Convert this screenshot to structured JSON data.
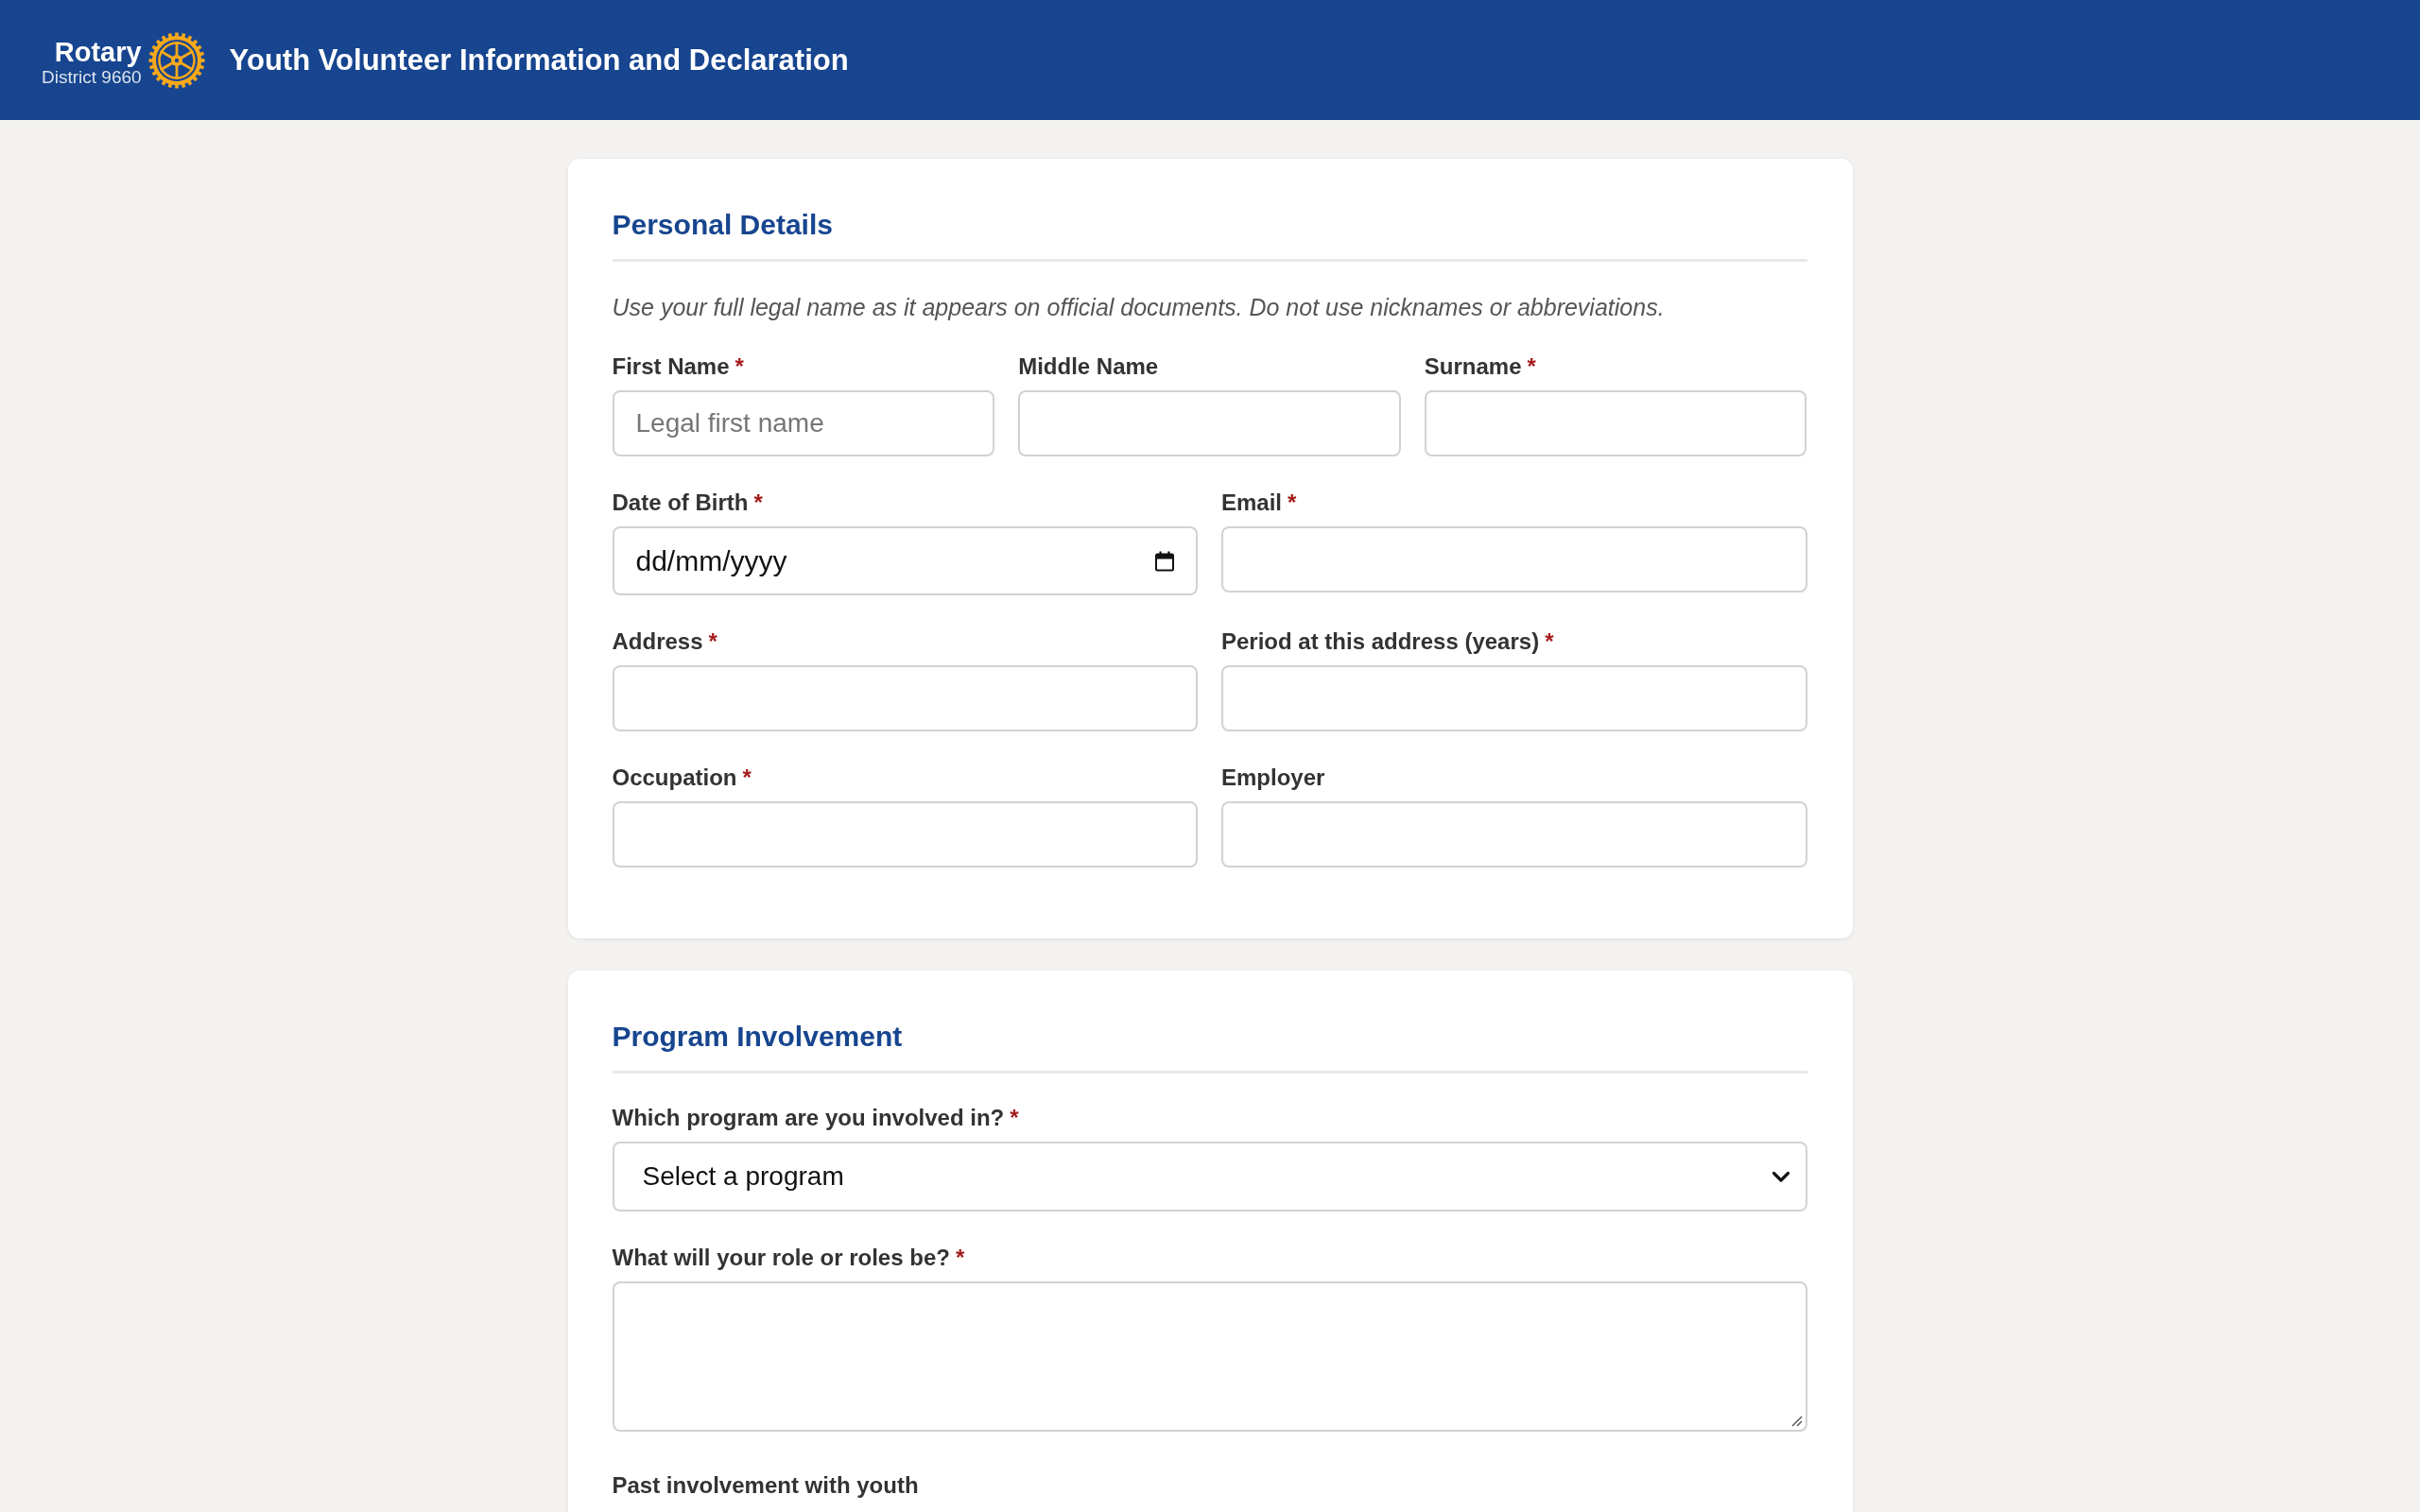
{
  "header": {
    "logo": {
      "wordmark": "Rotary",
      "district": "District 9660"
    },
    "title": "Youth Volunteer Information and Declaration"
  },
  "sections": [
    {
      "title": "Personal Details",
      "note": "Use your full legal name as it appears on official documents. Do not use nicknames or abbreviations.",
      "rows": [
        {
          "fields": [
            {
              "kind": "text",
              "label": "First Name",
              "required_mark": "*",
              "placeholder": "Legal first name"
            },
            {
              "kind": "text",
              "label": "Middle Name"
            },
            {
              "kind": "text",
              "label": "Surname",
              "required_mark": "*"
            }
          ]
        },
        {
          "fields": [
            {
              "kind": "date",
              "label": "Date of Birth",
              "required_mark": "*",
              "placeholder": "dd/mm/yyyy"
            },
            {
              "kind": "text",
              "label": "Email",
              "required_mark": "*"
            }
          ]
        },
        {
          "fields": [
            {
              "kind": "text",
              "label": "Address",
              "required_mark": "*"
            },
            {
              "kind": "text",
              "label": "Period at this address (years)",
              "required_mark": "*"
            }
          ]
        },
        {
          "fields": [
            {
              "kind": "text",
              "label": "Occupation",
              "required_mark": "*"
            },
            {
              "kind": "text",
              "label": "Employer"
            }
          ]
        }
      ]
    },
    {
      "title": "Program Involvement",
      "rows": [
        {
          "fields": [
            {
              "kind": "select",
              "label": "Which program are you involved in?",
              "required_mark": "*",
              "value": "Select a program"
            }
          ]
        },
        {
          "fields": [
            {
              "kind": "textarea",
              "label": "What will your role or roles be?",
              "required_mark": "*"
            }
          ]
        },
        {
          "fields": [
            {
              "kind": "label",
              "label": "Past involvement with youth"
            }
          ]
        }
      ]
    }
  ]
}
